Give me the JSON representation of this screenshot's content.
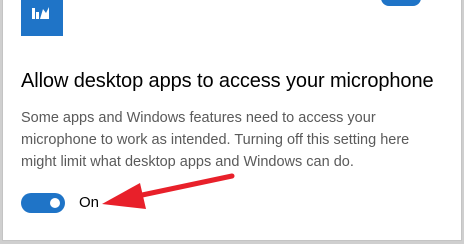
{
  "setting": {
    "heading": "Allow desktop apps to access your microphone",
    "description_lines": [
      "Some apps and Windows features need to access your",
      "microphone to work as intended. Turning off this setting here",
      "might limit what desktop apps and Windows can do."
    ],
    "toggle_state": "On"
  },
  "colors": {
    "accent": "#1f74c7",
    "annotation_arrow": "#e8202a"
  }
}
